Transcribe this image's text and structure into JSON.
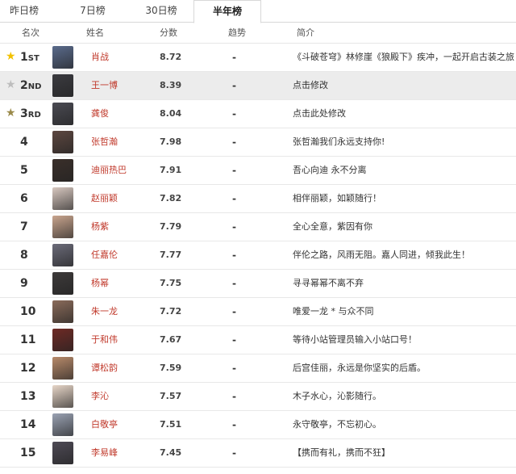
{
  "tabs": [
    {
      "label": "昨日榜",
      "active": false
    },
    {
      "label": "7日榜",
      "active": false
    },
    {
      "label": "30日榜",
      "active": false
    },
    {
      "label": "半年榜",
      "active": true
    }
  ],
  "header": {
    "rank": "名次",
    "name": "姓名",
    "score": "分数",
    "trend": "趋势",
    "intro": "简介"
  },
  "colors": {
    "gold_star": "#f2c100",
    "silver_star": "#bdbdbd",
    "bronze_star": "#9a8a4a",
    "name_link": "#c0392b",
    "highlight_row": "#ececec"
  },
  "rows": [
    {
      "rank": "1",
      "suffix": "ST",
      "star": "gold",
      "name": "肖战",
      "score": "8.72",
      "trend": "-",
      "intro": "《斗破苍穹》林修崖《狼殿下》疾冲，一起开启古装之旅",
      "avatar_color": "#5a6b8c"
    },
    {
      "rank": "2",
      "suffix": "ND",
      "star": "silver",
      "name": "王一博",
      "score": "8.39",
      "trend": "-",
      "intro": "点击修改",
      "avatar_color": "#3b3b40",
      "highlight": true
    },
    {
      "rank": "3",
      "suffix": "RD",
      "star": "bronze",
      "name": "龚俊",
      "score": "8.04",
      "trend": "-",
      "intro": "点击此处修改",
      "avatar_color": "#4a4a52"
    },
    {
      "rank": "4",
      "name": "张哲瀚",
      "score": "7.98",
      "trend": "-",
      "intro": "张哲瀚我们永远支持你!",
      "avatar_color": "#5c4740"
    },
    {
      "rank": "5",
      "name": "迪丽热巴",
      "score": "7.91",
      "trend": "-",
      "intro": "吾心向迪 永不分离",
      "avatar_color": "#3a2f2a"
    },
    {
      "rank": "6",
      "name": "赵丽颖",
      "score": "7.82",
      "trend": "-",
      "intro": "相伴丽颖，如颖随行！",
      "avatar_color": "#d8c8c0"
    },
    {
      "rank": "7",
      "name": "杨紫",
      "score": "7.79",
      "trend": "-",
      "intro": "全心全意，紫因有你",
      "avatar_color": "#c9a58e"
    },
    {
      "rank": "8",
      "name": "任嘉伦",
      "score": "7.77",
      "trend": "-",
      "intro": "伴伦之路，风雨无阻。嘉人同进，倾我此生！",
      "avatar_color": "#6a6a78"
    },
    {
      "rank": "9",
      "name": "杨幂",
      "score": "7.75",
      "trend": "-",
      "intro": "寻寻幂幂不离不弃",
      "avatar_color": "#3d3a3a"
    },
    {
      "rank": "10",
      "name": "朱一龙",
      "score": "7.72",
      "trend": "-",
      "intro": "唯爱一龙 * 与众不同",
      "avatar_color": "#8a6b5a"
    },
    {
      "rank": "11",
      "name": "于和伟",
      "score": "7.67",
      "trend": "-",
      "intro": "等待小站管理员输入小站口号！",
      "avatar_color": "#6e2a25"
    },
    {
      "rank": "12",
      "name": "谭松韵",
      "score": "7.59",
      "trend": "-",
      "intro": "后宫佳丽，永远是你坚实的后盾。",
      "avatar_color": "#b88a6a"
    },
    {
      "rank": "13",
      "name": "李沁",
      "score": "7.57",
      "trend": "-",
      "intro": "木子水心，沁影随行。",
      "avatar_color": "#e7d6c8"
    },
    {
      "rank": "14",
      "name": "白敬亭",
      "score": "7.51",
      "trend": "-",
      "intro": "永守敬亭，不忘初心。",
      "avatar_color": "#9aa2b3"
    },
    {
      "rank": "15",
      "name": "李易峰",
      "score": "7.45",
      "trend": "-",
      "intro": "【携而有礼，携而不狂】",
      "avatar_color": "#4e4a55"
    }
  ]
}
